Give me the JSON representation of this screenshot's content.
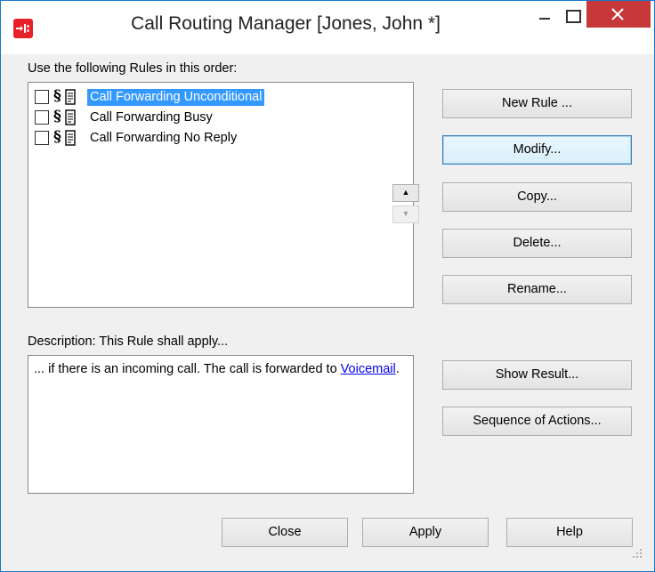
{
  "window": {
    "title": "Call Routing Manager [Jones, John *]"
  },
  "colors": {
    "accent": "#1979ca",
    "close_red": "#c7383a",
    "selection": "#3399ff",
    "link": "#0000ee"
  },
  "rules_label": "Use the following Rules in this order:",
  "rules": [
    {
      "label": "Call Forwarding Unconditional",
      "checked": false,
      "selected": true
    },
    {
      "label": "Call Forwarding Busy",
      "checked": false,
      "selected": false
    },
    {
      "label": "Call Forwarding No Reply",
      "checked": false,
      "selected": false
    }
  ],
  "buttons": {
    "new_rule": "New Rule ...",
    "modify": "Modify...",
    "copy": "Copy...",
    "delete": "Delete...",
    "rename": "Rename...",
    "show_result": "Show Result...",
    "sequence": "Sequence of Actions...",
    "close": "Close",
    "apply": "Apply",
    "help": "Help"
  },
  "description": {
    "label": "Description: This Rule shall apply...",
    "text_before_link": "... if there is an incoming call. The call is forwarded to ",
    "link": "Voicemail",
    "text_after_link": "."
  },
  "icons": {
    "app": "call-routing-app-icon",
    "rule": "paragraph-document-icon",
    "move_up": "triangle-up-icon",
    "move_down": "triangle-down-icon"
  }
}
